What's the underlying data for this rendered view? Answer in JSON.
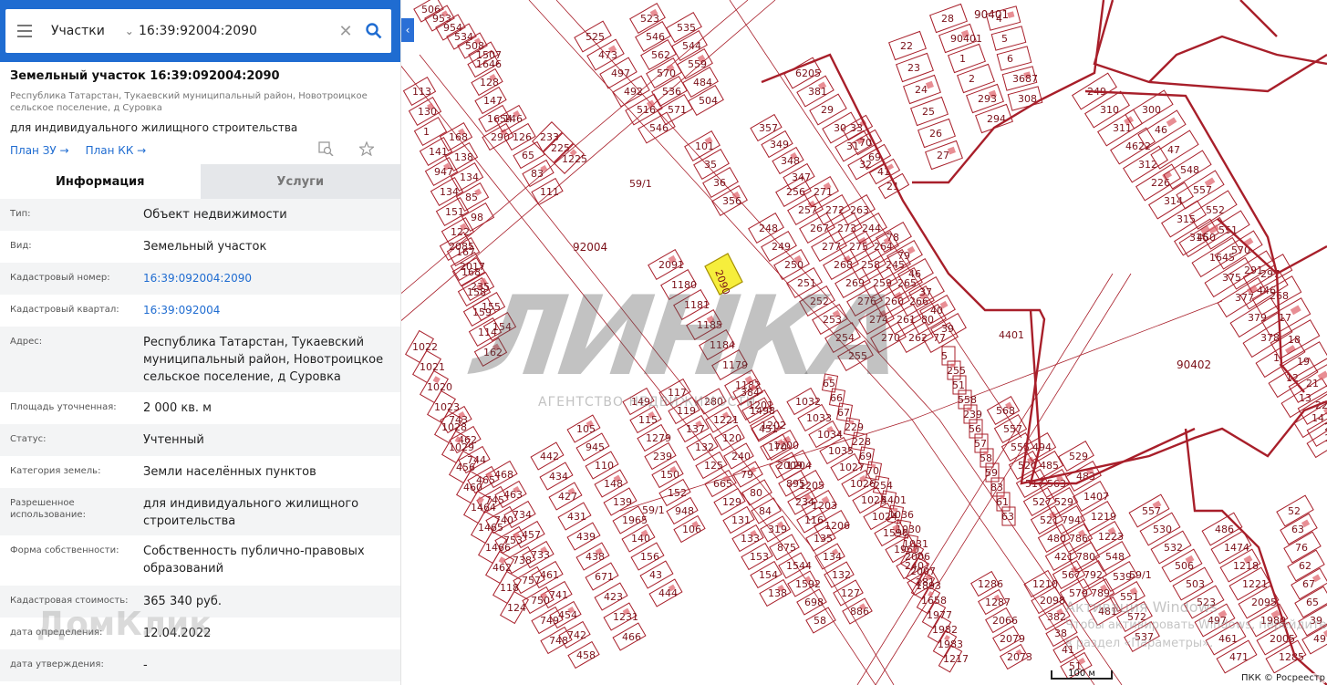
{
  "search": {
    "type_label": "Участки",
    "query": "16:39:92004:2090"
  },
  "plot": {
    "title": "Земельный участок 16:39:092004:2090",
    "address": "Республика Татарстан, Тукаевский муниципальный район, Новотроицкое сельское поселение, д Суровка",
    "use": "для индивидуального жилищного строительства",
    "link_zu": "План ЗУ →",
    "link_kk": "План КК →"
  },
  "tabs": {
    "info": "Информация",
    "services": "Услуги"
  },
  "info_rows": [
    {
      "label": "Тип:",
      "value": "Объект недвижимости"
    },
    {
      "label": "Вид:",
      "value": "Земельный участок"
    },
    {
      "label": "Кадастровый номер:",
      "value": "16:39:092004:2090"
    },
    {
      "label": "Кадастровый квартал:",
      "value": "16:39:092004"
    },
    {
      "label": "Адрес:",
      "value": "Республика Татарстан, Тукаевский муниципальный район, Новотроицкое сельское поселение, д Суровка"
    },
    {
      "label": "Площадь уточненная:",
      "value": "2 000 кв. м"
    },
    {
      "label": "Статус:",
      "value": "Учтенный"
    },
    {
      "label": "Категория земель:",
      "value": "Земли населённых пунктов"
    },
    {
      "label": "Разрешенное использование:",
      "value": "для индивидуального жилищного строительства"
    },
    {
      "label": "Форма собственности:",
      "value": "Собственность публично-правовых образований"
    },
    {
      "label": "Кадастровая стоимость:",
      "value": "365 340 руб."
    },
    {
      "label": "дата определения:",
      "value": "12.04.2022"
    },
    {
      "label": "дата утверждения:",
      "value": "-"
    }
  ],
  "watermarks": {
    "domclick": "ДомКлик",
    "agency": "АГЕНТСТВО НЕДВИЖИМОСТИ",
    "activation_line1": "Активация Windows",
    "activation_line2": "Чтобы активировать Windows, перейдите в раздел «Параметры»."
  },
  "map": {
    "selected_parcel": "2090",
    "block_labels": [
      "92004",
      "90401",
      "90402",
      "4401",
      "59/1",
      "59/1",
      "59/1"
    ],
    "scale_label": "100 м",
    "copyright": "ПКК © Росреестр",
    "parcel_labels": [
      "2091",
      "1180",
      "1181",
      "1185",
      "1184",
      "1179",
      "1182",
      "1201",
      "1202",
      "1200",
      "1204",
      "1205",
      "1203",
      "1206",
      "248",
      "249",
      "250",
      "251",
      "252",
      "253",
      "254",
      "255",
      "256",
      "257",
      "267",
      "277",
      "268",
      "269",
      "276",
      "274",
      "270",
      "271",
      "272",
      "273",
      "275",
      "258",
      "259",
      "260",
      "261",
      "262",
      "263",
      "244",
      "264",
      "245",
      "265",
      "266",
      "80",
      "77",
      "78",
      "79",
      "46",
      "37",
      "40",
      "39",
      "101",
      "35",
      "36",
      "356",
      "357",
      "349",
      "348",
      "347",
      "6205",
      "381",
      "29",
      "30",
      "31",
      "32",
      "33",
      "70",
      "69",
      "41",
      "21",
      "22",
      "23",
      "24",
      "25",
      "26",
      "27",
      "28",
      "90401",
      "1",
      "2",
      "293",
      "294",
      "4",
      "5",
      "6",
      "3687",
      "308",
      "249",
      "310",
      "311",
      "4622",
      "312",
      "226",
      "314",
      "315",
      "316",
      "300",
      "46",
      "47",
      "548",
      "557",
      "552",
      "551",
      "570",
      "291",
      "446",
      "450",
      "1645",
      "375",
      "377",
      "379",
      "378",
      "1",
      "12",
      "13",
      "14",
      "15",
      "297",
      "268",
      "17",
      "18",
      "19",
      "21",
      "22",
      "23",
      "5",
      "255",
      "51",
      "558",
      "239",
      "56",
      "57",
      "58",
      "59",
      "83",
      "61",
      "63",
      "65",
      "66",
      "67",
      "229",
      "228",
      "69",
      "70",
      "254",
      "4401",
      "1036",
      "1030",
      "1031",
      "1032",
      "1033",
      "1034",
      "1035",
      "1027",
      "1026",
      "1025",
      "1024",
      "1590",
      "1960",
      "240",
      "281",
      "280",
      "1221",
      "120",
      "240",
      "79",
      "80",
      "84",
      "319",
      "875",
      "1544",
      "1592",
      "698",
      "58",
      "384",
      "1498",
      "451",
      "170",
      "2009",
      "895",
      "234",
      "116",
      "135",
      "134",
      "132",
      "127",
      "886",
      "117",
      "119",
      "137",
      "132",
      "125",
      "665",
      "129",
      "131",
      "133",
      "153",
      "154",
      "138",
      "149",
      "115",
      "1279",
      "239",
      "150",
      "152",
      "948",
      "106",
      "105",
      "945",
      "110",
      "148",
      "139",
      "1965",
      "140",
      "156",
      "43",
      "444",
      "442",
      "434",
      "427",
      "431",
      "439",
      "438",
      "671",
      "423",
      "1231",
      "466",
      "468",
      "463",
      "734",
      "457",
      "733",
      "461",
      "741",
      "454",
      "742",
      "458",
      "743",
      "462",
      "744",
      "465",
      "745",
      "740",
      "753",
      "738",
      "757",
      "750",
      "749",
      "748",
      "1022",
      "1021",
      "1020",
      "1023",
      "1028",
      "1029",
      "456",
      "460",
      "1464",
      "1465",
      "1466",
      "462",
      "118",
      "124",
      "113",
      "130",
      "1",
      "141",
      "947",
      "134",
      "151",
      "122",
      "167",
      "168",
      "158",
      "159",
      "114",
      "162",
      "168",
      "138",
      "134",
      "85",
      "98",
      "2085",
      "2017",
      "235",
      "155",
      "154",
      "1646",
      "128",
      "147",
      "1654",
      "290",
      "146",
      "126",
      "65",
      "83",
      "111",
      "233",
      "225",
      "1225",
      "525",
      "473",
      "497",
      "492",
      "516",
      "546",
      "523",
      "546",
      "562",
      "570",
      "536",
      "571",
      "535",
      "544",
      "559",
      "484",
      "504",
      "506",
      "953",
      "954",
      "534",
      "508",
      "1507",
      "568",
      "557",
      "555",
      "520",
      "517",
      "527",
      "521",
      "480",
      "421",
      "567",
      "579",
      "494",
      "485",
      "563",
      "529",
      "794",
      "786",
      "780",
      "792",
      "789",
      "481",
      "529",
      "483",
      "1407",
      "1219",
      "1223",
      "548",
      "539",
      "551",
      "572",
      "537",
      "557",
      "530",
      "532",
      "506",
      "503",
      "523",
      "497",
      "461",
      "471",
      "486",
      "1474",
      "1218",
      "1221",
      "2095",
      "1980",
      "2005",
      "1285",
      "1286",
      "1287",
      "2066",
      "2079",
      "2073",
      "2006",
      "2007",
      "1893",
      "1658",
      "1977",
      "1982",
      "1983",
      "1217",
      "1210",
      "2098",
      "382",
      "38",
      "41",
      "51",
      "52",
      "63",
      "76",
      "62",
      "67",
      "65",
      "39",
      "49",
      "1365",
      "354",
      "357",
      "355",
      "353",
      "367",
      "366",
      "364",
      "365",
      "366",
      "361",
      "353",
      "2077",
      "68",
      "75",
      "60",
      "61",
      "74",
      "153",
      "72",
      "112",
      "71",
      "73",
      "82",
      "100",
      "85",
      "67",
      "69",
      "1219",
      "1221",
      "1212",
      "1223",
      "1201"
    ]
  }
}
